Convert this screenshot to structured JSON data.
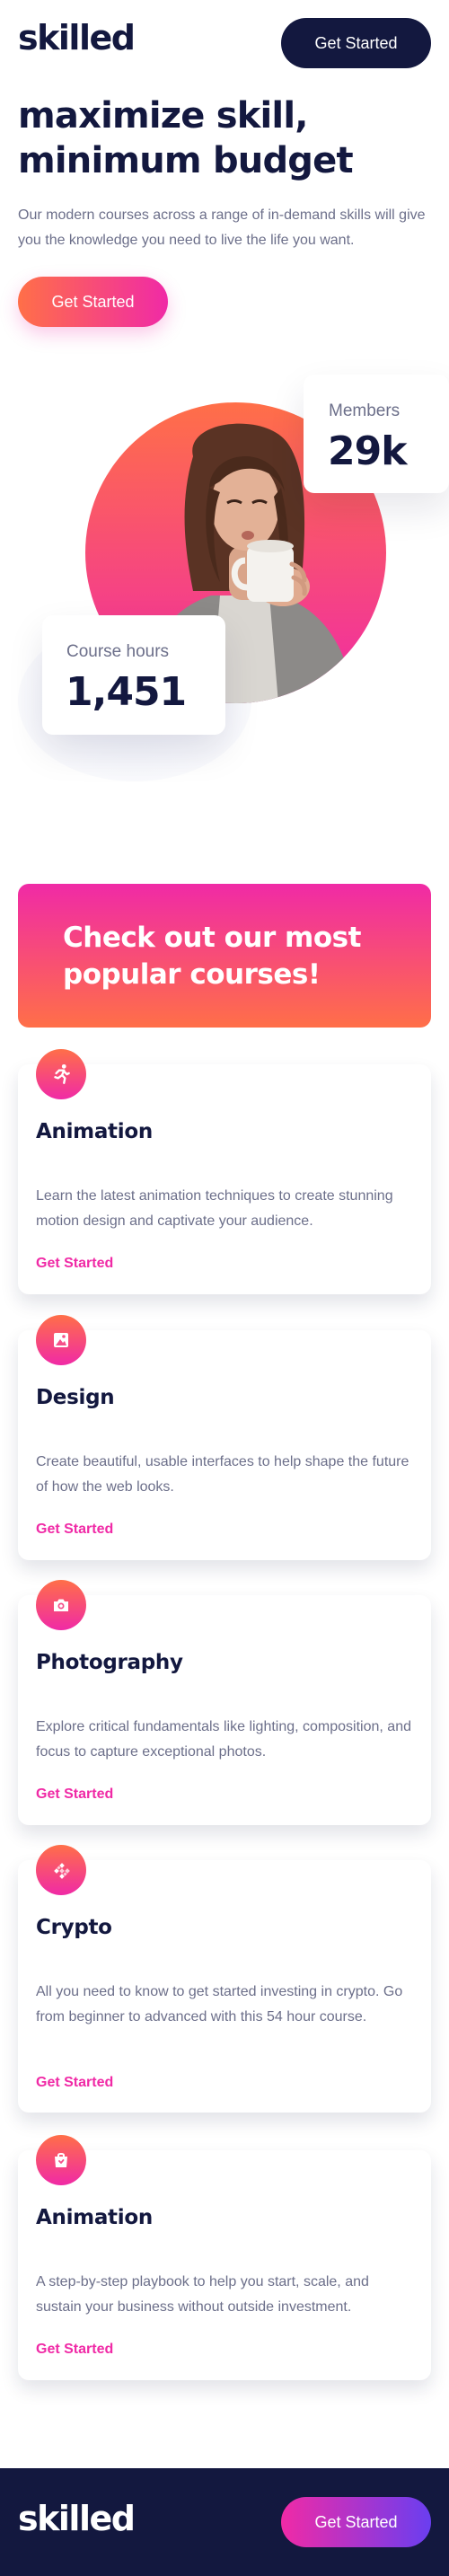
{
  "header": {
    "logo": "skilled",
    "cta_label": "Get Started"
  },
  "hero": {
    "title_line1": "maximize skill,",
    "title_line2": "minimum budget",
    "description": "Our modern courses across a range of in-demand skills will give you the knowledge you need to live the life you want.",
    "cta_label": "Get Started"
  },
  "stats": {
    "members_label": "Members",
    "members_value": "29k",
    "hours_label": "Course hours",
    "hours_value": "1,451"
  },
  "courses_section": {
    "title_line1": "Check out our most",
    "title_line2": "popular courses!"
  },
  "courses": [
    {
      "icon": "running-person-icon",
      "title": "Animation",
      "description": "Learn the latest animation techniques to create stunning motion design and captivate your audience.",
      "link_label": "Get Started"
    },
    {
      "icon": "design-image-icon",
      "title": "Design",
      "description": "Create beautiful, usable interfaces to help shape the future of how the web looks.",
      "link_label": "Get Started"
    },
    {
      "icon": "camera-icon",
      "title": "Photography",
      "description": "Explore critical fundamentals like lighting, composition, and focus to capture exceptional photos.",
      "link_label": "Get Started"
    },
    {
      "icon": "crypto-icon",
      "title": "Crypto",
      "description": "All you need to know to get started investing in crypto. Go from beginner to advanced with this 54 hour course.",
      "link_label": "Get Started"
    },
    {
      "icon": "shopping-bag-icon",
      "title": "Animation",
      "description": "A step-by-step playbook to help you start, scale, and sustain your business without outside investment.",
      "link_label": "Get Started"
    }
  ],
  "footer": {
    "logo": "skilled",
    "cta_label": "Get Started"
  },
  "colors": {
    "navy": "#13183f",
    "orange": "#ff6f48",
    "pink": "#f02aa6",
    "purple": "#6a3ef0",
    "muted_text": "#6c6f8a"
  }
}
